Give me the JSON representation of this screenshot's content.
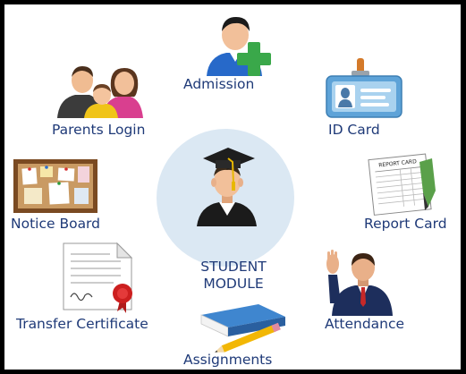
{
  "center": {
    "line1": "STUDENT",
    "line2": "MODULE",
    "icon": "graduate-icon"
  },
  "modules": {
    "admission": {
      "label": "Admission",
      "icon": "admission-icon"
    },
    "parents_login": {
      "label": "Parents Login",
      "icon": "parents-icon"
    },
    "id_card": {
      "label": "ID Card",
      "icon": "id-card-icon"
    },
    "notice_board": {
      "label": "Notice Board",
      "icon": "notice-board-icon"
    },
    "report_card": {
      "label": "Report Card",
      "icon": "report-card-icon"
    },
    "transfer_certificate": {
      "label": "Transfer Certificate",
      "icon": "certificate-icon"
    },
    "attendance": {
      "label": "Attendance",
      "icon": "attendance-icon"
    },
    "assignments": {
      "label": "Assignments",
      "icon": "assignments-icon"
    },
    "report_card_header": "REPORT CARD"
  },
  "colors": {
    "label": "#1f3a78",
    "center_circle": "#dbe8f3",
    "frame": "#000000",
    "background": "#ffffff"
  }
}
